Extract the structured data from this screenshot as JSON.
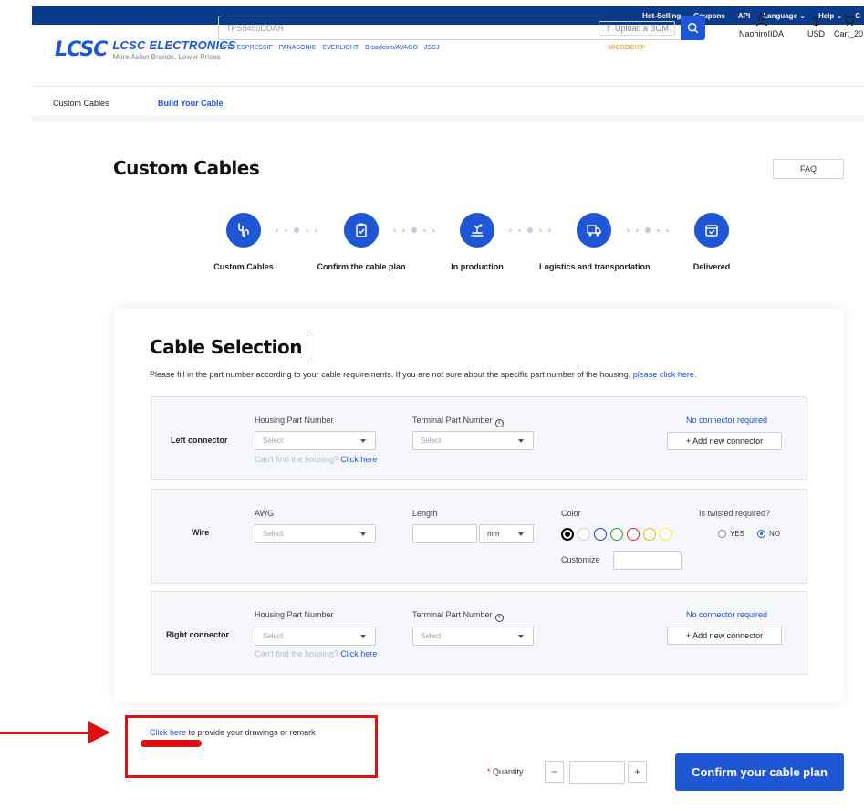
{
  "topbar": {
    "links": [
      "Hot-Selling",
      "Coupons",
      "API",
      "Language ⌄",
      "Help ⌄",
      "C"
    ]
  },
  "header": {
    "logo_mark": "LCSC",
    "brand": "LCSC ELECTRONICS",
    "tagline": "More Asian Brands, Lower Prices",
    "search_placeholder": "TPS5450DDAR",
    "upload_label": "Upload a BOM",
    "hot_brands": [
      "JST",
      "ESPRESSIF",
      "PANASONIC",
      "EVERLIGHT",
      "Broadcom/AVAGO",
      "JSCJ"
    ],
    "promo_brand": "MICROCHIP",
    "account_name": "NaohiroIIDA",
    "currency": "USD",
    "currency_symbol": "$",
    "cart_label": "Cart_20"
  },
  "subnav": {
    "item1": "Custom Cables",
    "item2": "Build Your Cable"
  },
  "page": {
    "title": "Custom Cables",
    "faq": "FAQ"
  },
  "steps": [
    {
      "label": "Custom Cables",
      "icon": "cable-icon"
    },
    {
      "label": "Confirm the cable plan",
      "icon": "clipboard-check-icon"
    },
    {
      "label": "In production",
      "icon": "production-icon"
    },
    {
      "label": "Logistics and transportation",
      "icon": "truck-icon"
    },
    {
      "label": "Delivered",
      "icon": "delivered-check-icon"
    }
  ],
  "selection": {
    "title": "Cable Selection",
    "intro": "Please fill in the part number according to your cable requirements. If you are not sure about the specific part number of the housing, ",
    "intro_link": "please click here.",
    "left": {
      "label": "Left connector",
      "housing_label": "Housing Part Number",
      "housing_value": "Select",
      "terminal_label": "Terminal Part Number",
      "terminal_value": "Select",
      "hint": "Can't find the housing? ",
      "hint_link": "Click here",
      "no_conn": "No connector required",
      "add_btn": "+ Add new connector"
    },
    "wire": {
      "label": "Wire",
      "awg_label": "AWG",
      "awg_value": "Select",
      "length_label": "Length",
      "length_value": "",
      "unit_value": "mm",
      "color_label": "Color",
      "colors": [
        "#000000",
        "#ffffff",
        "#1a3ccf",
        "#1f9a2e",
        "#e0262b",
        "#f1b321",
        "#f6ec3a"
      ],
      "customize_label": "Customize",
      "twisted_label": "Is twisted required?",
      "yes": "YES",
      "no": "NO",
      "twisted_selected": "NO"
    },
    "right": {
      "label": "Right connector",
      "housing_label": "Housing Part Number",
      "housing_value": "Select",
      "terminal_label": "Terminal Part Number",
      "terminal_value": "Select",
      "hint": "Can't find the housing? ",
      "hint_link": "Click here",
      "no_conn": "No connector required",
      "add_btn": "+ Add new connector"
    }
  },
  "remark": {
    "link": "Click here",
    "text": " to provide your drawings or remark"
  },
  "quantity": {
    "required": "*",
    "label": " Quantity",
    "minus": "−",
    "plus": "+",
    "value": ""
  },
  "confirm_label": "Confirm your cable plan"
}
